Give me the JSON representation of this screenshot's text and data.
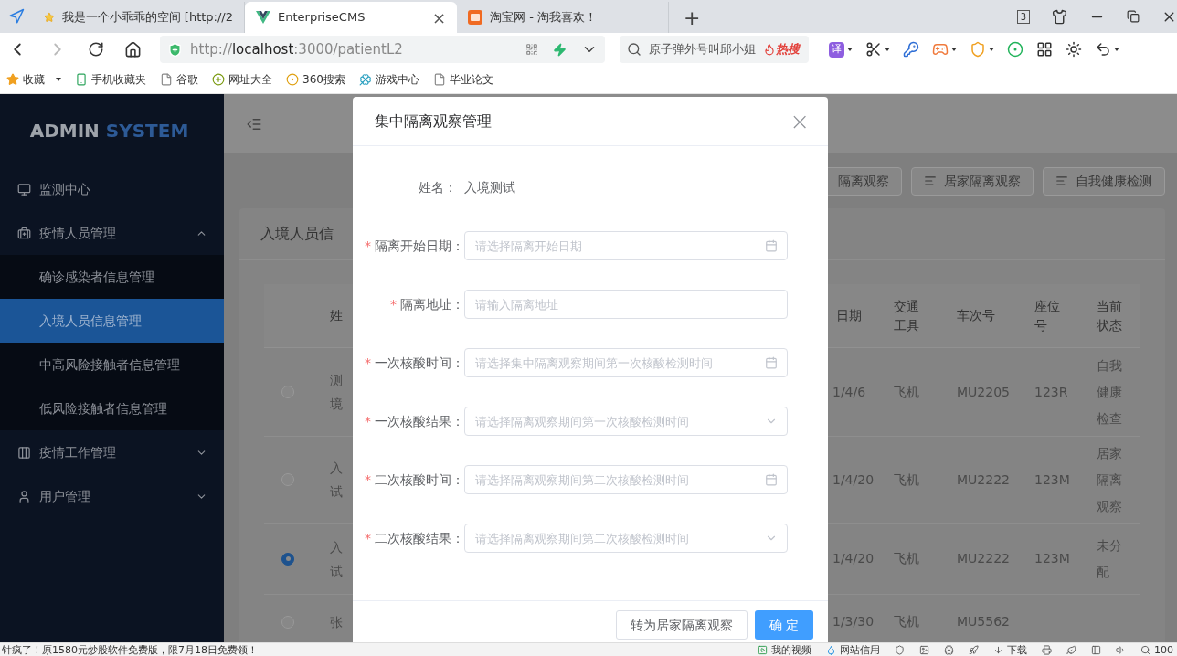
{
  "browser": {
    "tabs": [
      {
        "title": "我是一个小乖乖的空间 [http://2",
        "selected": false
      },
      {
        "title": "EnterpriseCMS",
        "selected": true,
        "close": "×"
      },
      {
        "title": "淘宝网 - 淘我喜欢！",
        "selected": false
      }
    ],
    "new_tab": "+",
    "tab_count": "3",
    "address": {
      "scheme": "http://",
      "host": "localhost",
      "rest": ":3000/patientL2"
    },
    "search": {
      "value": "原子弹外号叫邱小姐",
      "hot": "热搜"
    },
    "translate": "译",
    "bookmarks": [
      "收藏",
      "手机收藏夹",
      "谷歌",
      "网址大全",
      "360搜索",
      "游戏中心",
      "毕业论文"
    ]
  },
  "sidebar": {
    "logo_a": "ADMIN",
    "logo_b": "SYSTEM",
    "menu": [
      {
        "label": "监测中心",
        "selected": false
      },
      {
        "label": "疫情人员管理",
        "selected": false,
        "expanded": true,
        "children": [
          {
            "label": "确诊感染者信息管理",
            "selected": false
          },
          {
            "label": "入境人员信息管理",
            "selected": true
          },
          {
            "label": "中高风险接触者信息管理",
            "selected": false
          },
          {
            "label": "低风险接触者信息管理",
            "selected": false
          }
        ]
      },
      {
        "label": "疫情工作管理",
        "selected": false,
        "expanded": false
      },
      {
        "label": "用户管理",
        "selected": false,
        "expanded": false
      }
    ]
  },
  "actions": [
    "隔离观察",
    "居家隔离观察",
    "自我健康检测"
  ],
  "card": {
    "title": "入境人员信",
    "columns": [
      "姓",
      "日期",
      "交通工具",
      "车次号",
      "座位号",
      "当前状态"
    ],
    "rows": [
      {
        "selected": false,
        "name": [
          "测",
          "境"
        ],
        "date": "1/4/6",
        "tool": "飞机",
        "train": "MU2205",
        "seat": "123R",
        "status": "自我健康检查"
      },
      {
        "selected": false,
        "name": [
          "入",
          "试"
        ],
        "date": "1/4/20",
        "tool": "飞机",
        "train": "MU2222",
        "seat": "123M",
        "status": "居家隔离观察"
      },
      {
        "selected": true,
        "name": [
          "入",
          "试"
        ],
        "date": "1/4/20",
        "tool": "飞机",
        "train": "MU2222",
        "seat": "123M",
        "status": "未分配"
      },
      {
        "selected": false,
        "name": [
          "张"
        ],
        "date": "1/3/30",
        "tool": "飞机",
        "train": "MU5562"
      }
    ]
  },
  "dialog": {
    "title": "集中隔离观察管理",
    "close": "×",
    "name_label": "姓名：",
    "name_value": "入境测试",
    "fields": [
      {
        "kind": "date",
        "mark": "*",
        "label": "隔离开始日期：",
        "placeholder": "请选择隔离开始日期"
      },
      {
        "kind": "input",
        "mark": "*",
        "label": "隔离地址：",
        "placeholder": "请输入隔离地址"
      },
      {
        "kind": "date",
        "mark": "*",
        "label": "一次核酸时间：",
        "placeholder": "请选择集中隔离观察期间第一次核酸检测时间"
      },
      {
        "kind": "select",
        "mark": "*",
        "label": "一次核酸结果：",
        "placeholder": "请选择隔离观察期间第一次核酸检测时间"
      },
      {
        "kind": "date",
        "mark": "*",
        "label": "二次核酸时间：",
        "placeholder": "请选择隔离观察期间第二次核酸检测时间"
      },
      {
        "kind": "select",
        "mark": "*",
        "label": "二次核酸结果：",
        "placeholder": "请选择隔离观察期间第二次核酸检测时间"
      }
    ],
    "buttons": [
      {
        "label": "转为居家隔离观察",
        "primary": false
      },
      {
        "label": "确 定",
        "primary": true
      }
    ]
  },
  "status_bar": {
    "ad": "针疯了！原1580元炒股软件免费版，限7月18日免费领！",
    "items": [
      "我的视频",
      "网站信用",
      "下载",
      "100"
    ]
  }
}
